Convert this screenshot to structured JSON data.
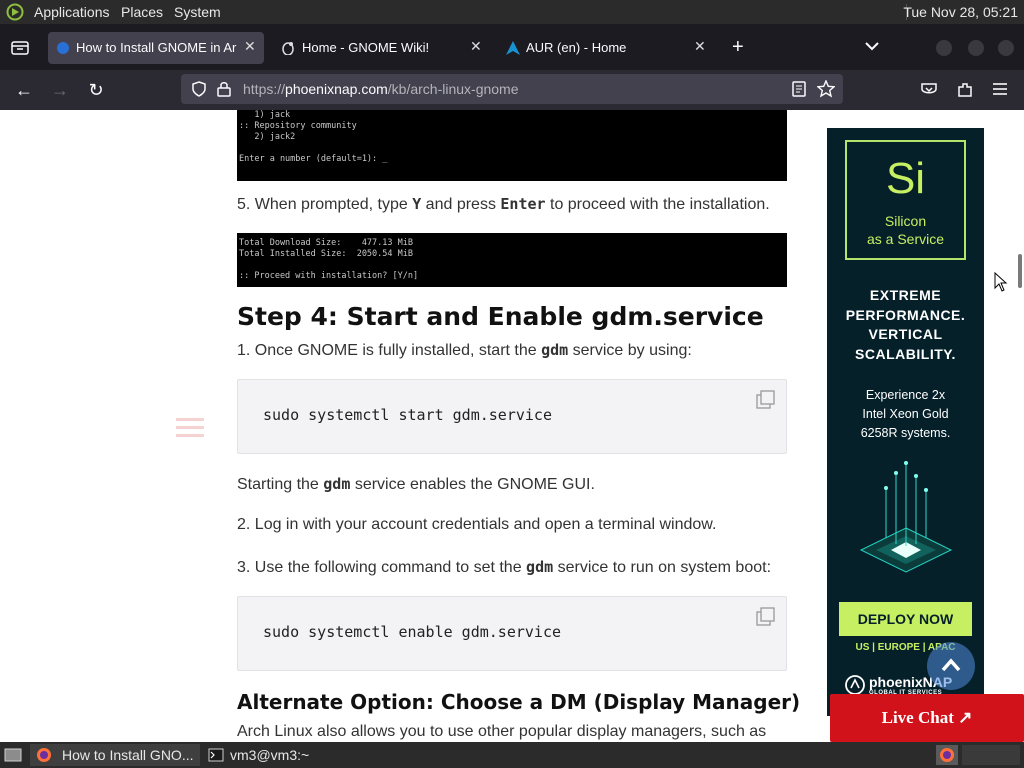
{
  "top_panel": {
    "menus": [
      "Applications",
      "Places",
      "System"
    ],
    "clock": "Tue Nov 28, 05:21"
  },
  "tabs": [
    {
      "label": "How to Install GNOME in Ar",
      "active": true
    },
    {
      "label": "Home - GNOME Wiki!",
      "active": false
    },
    {
      "label": "AUR (en) - Home",
      "active": false
    }
  ],
  "url": {
    "prefix": "https://",
    "host": "phoenixnap.com",
    "path": "/kb/arch-linux-gnome"
  },
  "article": {
    "terminal_top_lines": "   1) jack\n:: Repository community\n   2) jack2\n\nEnter a number (default=1): _",
    "step5": {
      "prefix": "5. When prompted, type ",
      "key1": "Y",
      "middle": " and press ",
      "key2": "Enter",
      "suffix": " to proceed with the installation."
    },
    "terminal_mid_lines": "Total Download Size:    477.13 MiB\nTotal Installed Size:  2050.54 MiB\n\n:: Proceed with installation? [Y/n]",
    "step4_heading": "Step 4: Start and Enable gdm.service",
    "step4_1": {
      "prefix": "1. Once GNOME is fully installed, start the ",
      "key": "gdm",
      "suffix": " service by using:"
    },
    "code1": "sudo systemctl start gdm.service",
    "gdm_note": {
      "prefix": "Starting the ",
      "key": "gdm",
      "suffix": " service enables the GNOME GUI."
    },
    "step4_2": "2. Log in with your account credentials and open a terminal window.",
    "step4_3": {
      "prefix": "3. Use the following command to set the ",
      "key": "gdm",
      "suffix": " service to run on system boot:"
    },
    "code2": "sudo systemctl enable gdm.service",
    "alt_heading": "Alternate Option: Choose a DM (Display Manager)",
    "alt_text": "Arch Linux also allows you to use other popular display managers, such as"
  },
  "ad": {
    "symbol": "Si",
    "symbol_sub": "Silicon\nas a Service",
    "headline": "EXTREME\nPERFORMANCE.\nVERTICAL\nSCALABILITY.",
    "body": "Experience 2x\nIntel Xeon Gold\n6258R systems.",
    "cta": "DEPLOY NOW",
    "regions": "US | EUROPE | APAC",
    "brand": "phoenixNAP",
    "brand_sub": "GLOBAL IT SERVICES"
  },
  "live_chat": "Live Chat ↗",
  "taskbar": [
    {
      "label": "How to Install GNO...",
      "active": true
    },
    {
      "label": "vm3@vm3:~",
      "active": false
    }
  ],
  "colors": {
    "accent_green": "#c6ef62",
    "live_chat_red": "#d1121a",
    "ad_bg": "#06202a"
  }
}
